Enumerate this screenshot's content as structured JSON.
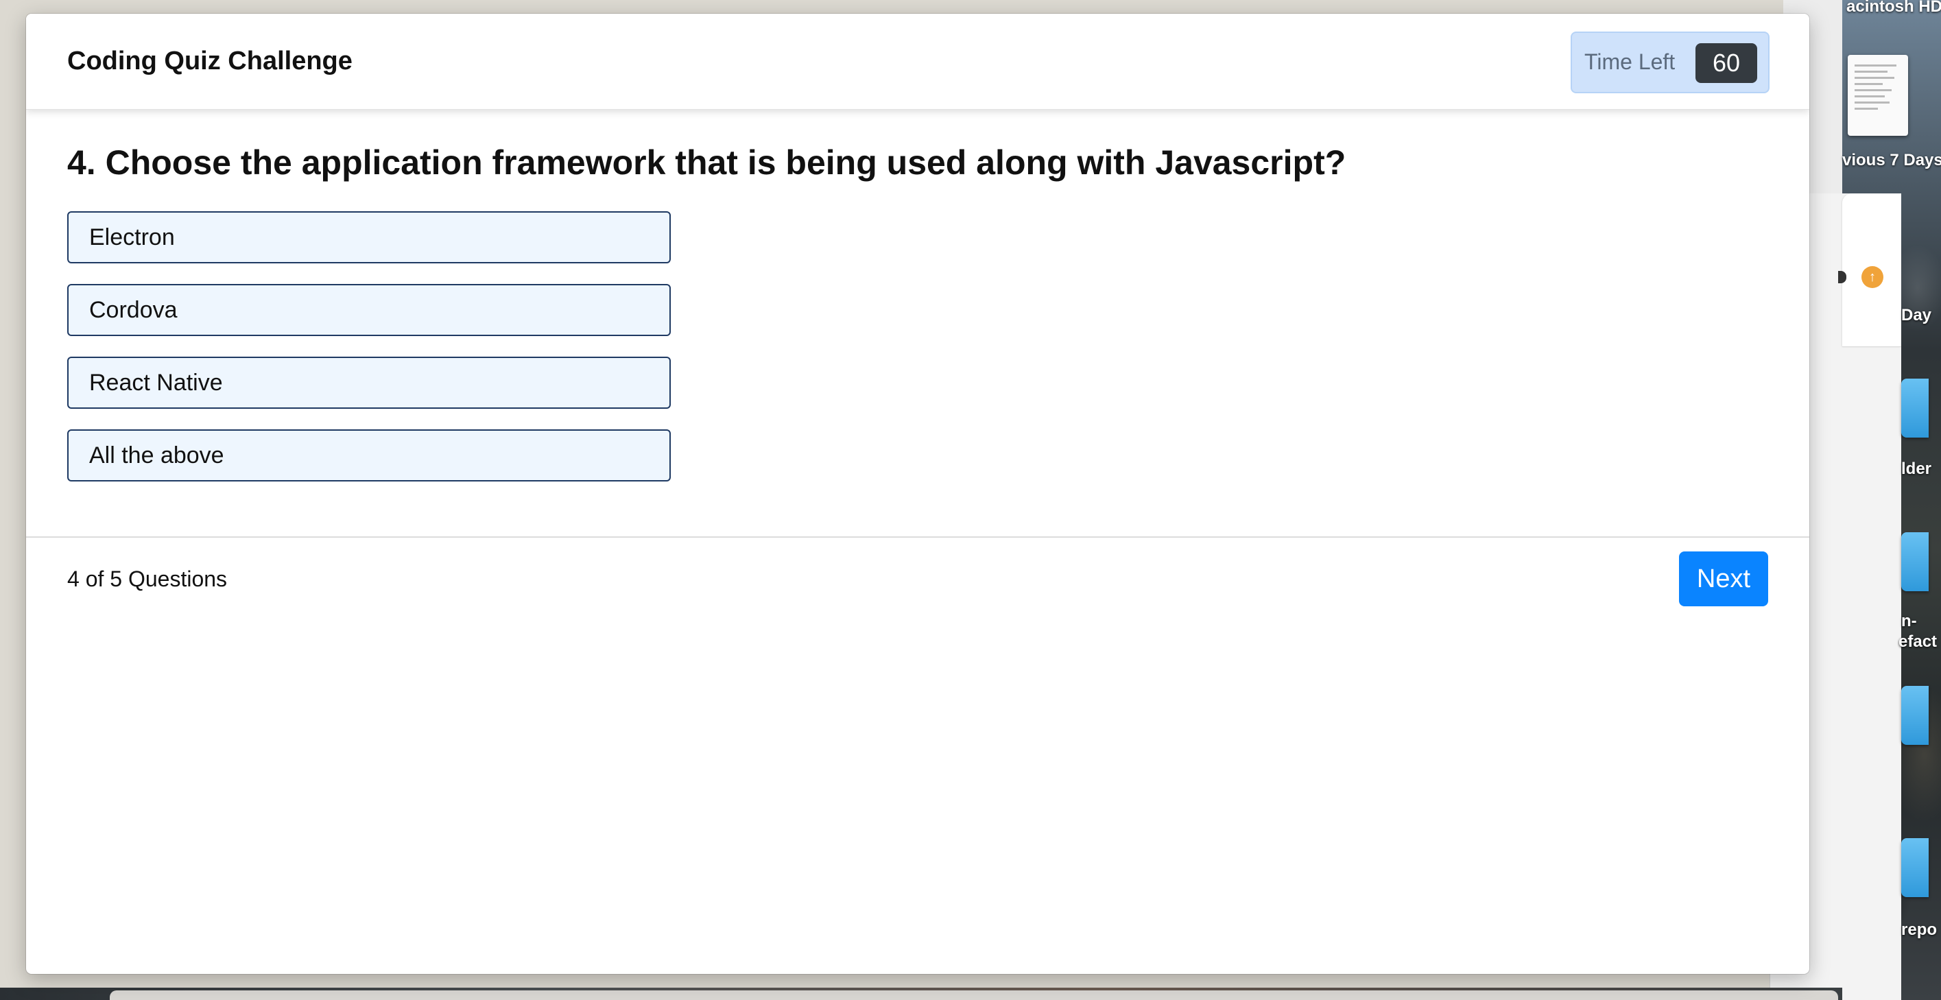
{
  "app": {
    "title": "Coding Quiz Challenge",
    "timer_label": "Time Left",
    "timer_value": "60"
  },
  "quiz": {
    "question": "4. Choose the application framework that is being used along with Javascript?",
    "options": [
      {
        "label": "Electron"
      },
      {
        "label": "Cordova"
      },
      {
        "label": "React Native"
      },
      {
        "label": "All the above"
      }
    ],
    "progress_text": "4 of 5 Questions",
    "next_label": "Next",
    "accent_color": "#0a84ff"
  },
  "desktop": {
    "labels": [
      "acintosh HD",
      "vious 7 Days",
      "Day",
      "lder",
      "n-",
      "efact",
      "repo"
    ]
  }
}
